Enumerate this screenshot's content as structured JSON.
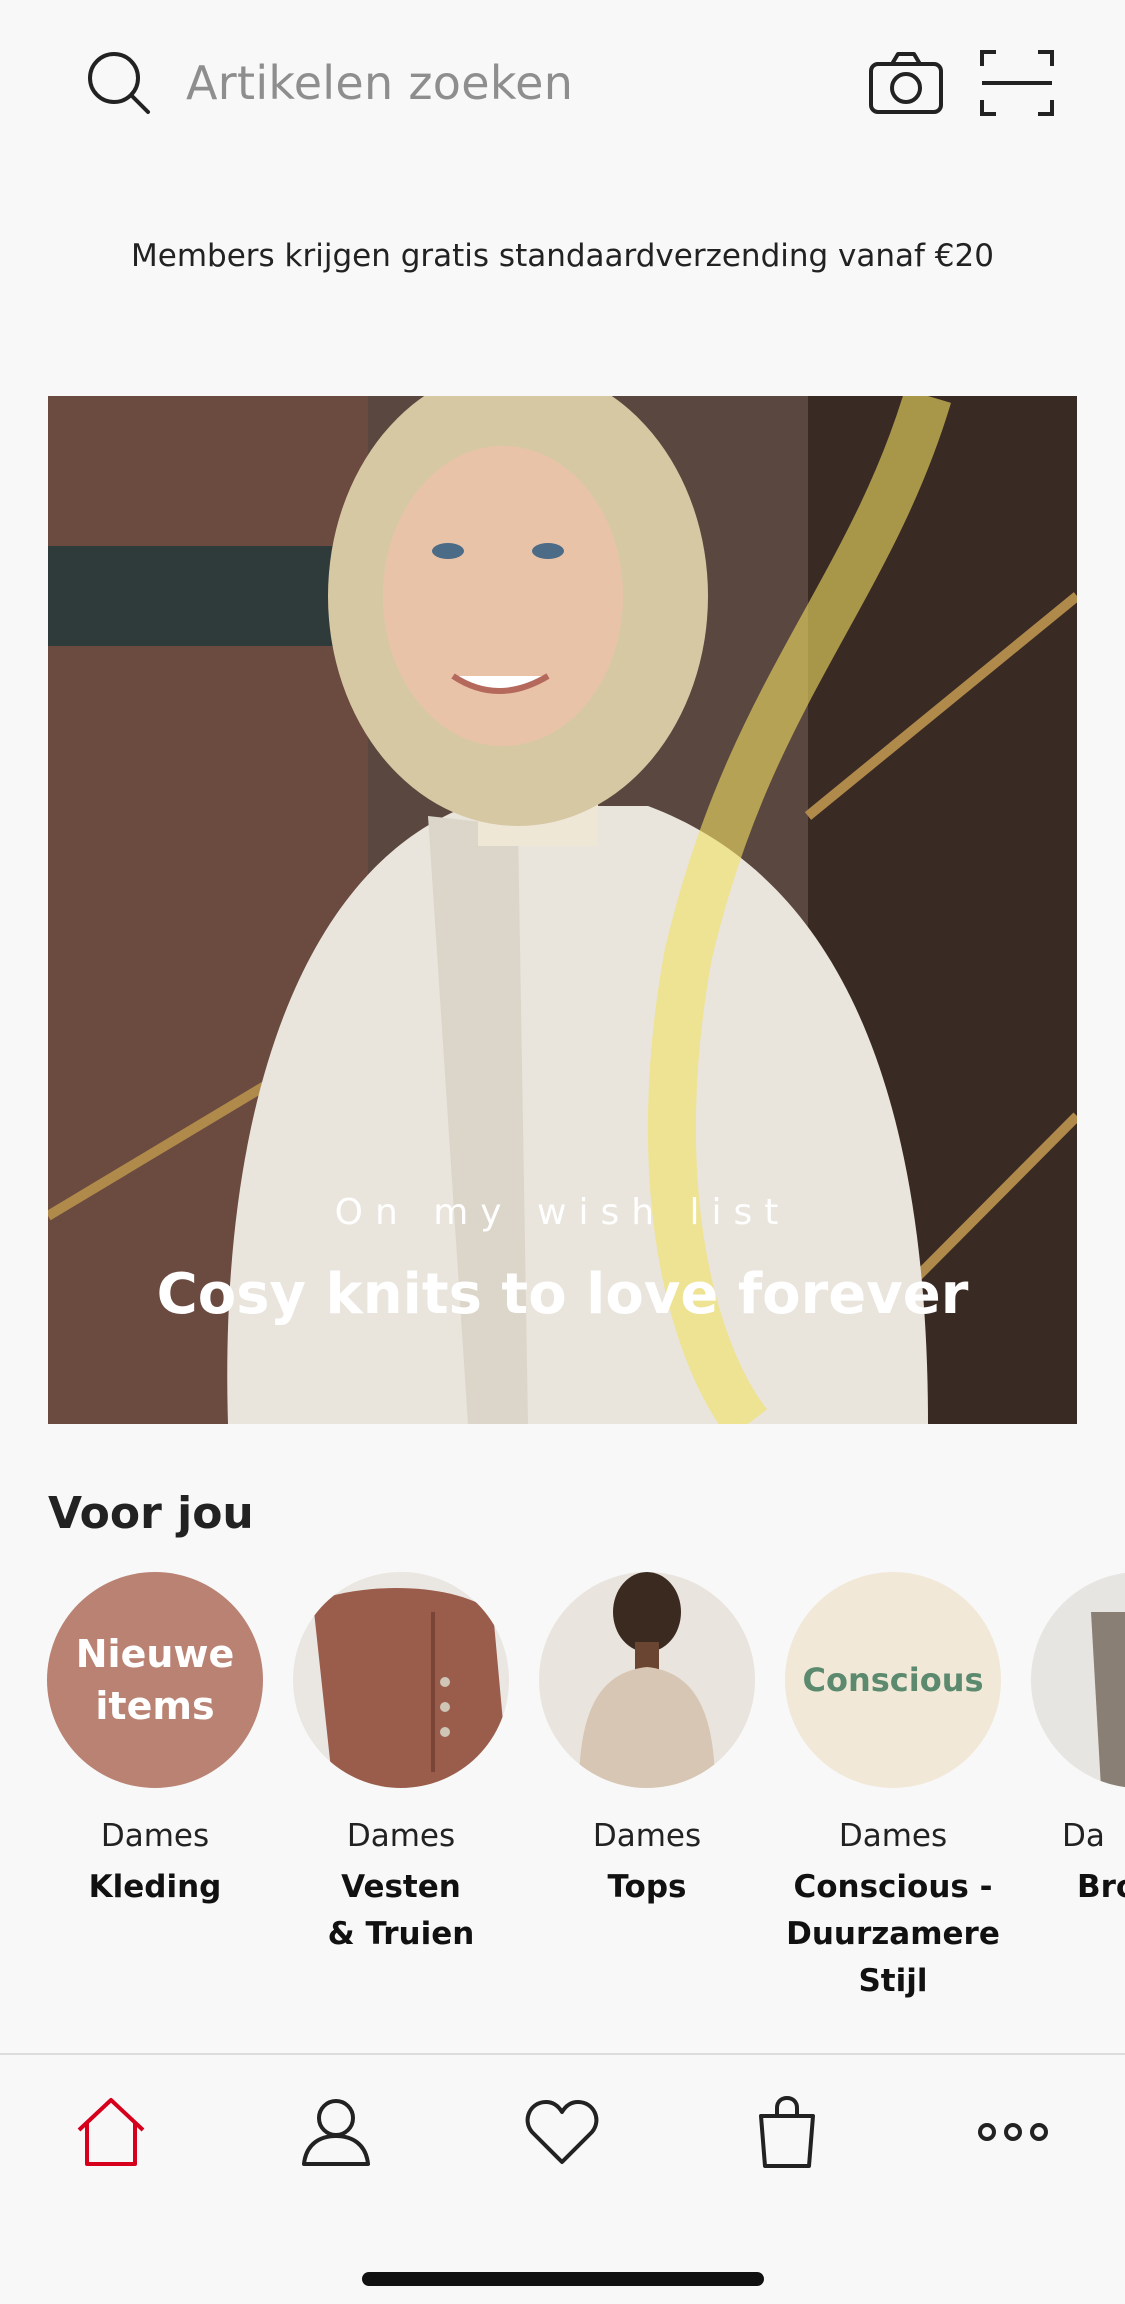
{
  "search": {
    "placeholder": "Artikelen zoeken"
  },
  "promo": {
    "text": "Members krijgen gratis standaardverzending vanaf €20"
  },
  "hero": {
    "kicker": "On my wish list",
    "title": "Cosy knits to love forever"
  },
  "section": {
    "title": "Voor jou"
  },
  "categories": [
    {
      "badge": "Nieuwe\nitems",
      "sub": "Dames",
      "name": "Kleding",
      "color": "#b98273"
    },
    {
      "badge": "",
      "sub": "Dames",
      "name": "Vesten\n& Truien",
      "color": "#9a5d4c"
    },
    {
      "badge": "",
      "sub": "Dames",
      "name": "Tops",
      "color": "#e9e4de"
    },
    {
      "badge": "Conscious",
      "sub": "Dames",
      "name": "Conscious -\nDuurzamere\nStijl",
      "color": "#f1e8d8"
    },
    {
      "badge": "",
      "sub": "Da",
      "name": "Bro",
      "color": "#e7e5e2"
    }
  ],
  "tabs": [
    "home",
    "account",
    "favorites",
    "bag",
    "more"
  ],
  "colors": {
    "accent": "#d6001c",
    "text": "#222222"
  }
}
